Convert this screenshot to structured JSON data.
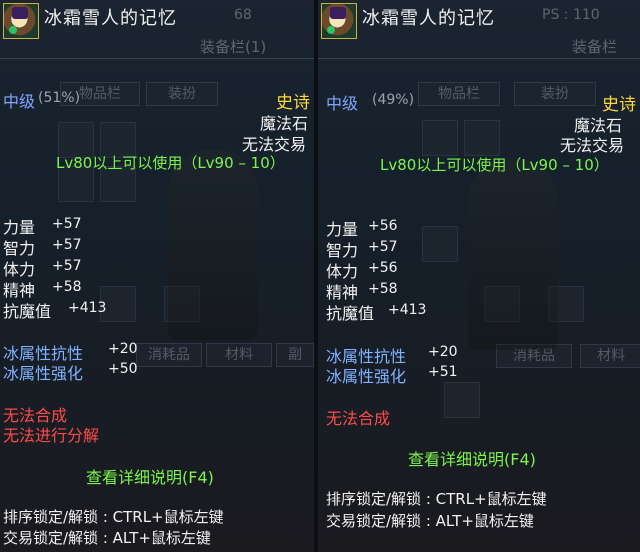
{
  "left": {
    "item_name": "冰霜雪人的记忆",
    "header_faded": "68",
    "window_title": "装备栏(1)",
    "bg_tabs": [
      "物品栏",
      "装扮",
      "消耗品",
      "材料",
      "副"
    ],
    "grade": "中级",
    "grade_pct": "(51%)",
    "rarity": "史诗",
    "item_type": "魔法石",
    "trade": "无法交易",
    "level_req": "Lv80以上可以使用（Lv90 – 10）",
    "stats": [
      {
        "name": "力量",
        "value": "+57"
      },
      {
        "name": "智力",
        "value": "+57"
      },
      {
        "name": "体力",
        "value": "+57"
      },
      {
        "name": "精神",
        "value": "+58"
      },
      {
        "name": "抗魔值",
        "value": "+413"
      }
    ],
    "elem": [
      {
        "name": "冰属性抗性",
        "value": "+20"
      },
      {
        "name": "冰属性强化",
        "value": "+50"
      }
    ],
    "no_synth": "无法合成",
    "no_decompose": "无法进行分解",
    "detail_btn": "查看详细说明(F4)",
    "lock_sort": "排序锁定/解锁 : CTRL+鼠标左键",
    "lock_trade": "交易锁定/解锁 : ALT+鼠标左键"
  },
  "right": {
    "item_name": "冰霜雪人的记忆",
    "header_faded": "PS : 110",
    "window_title": "装备栏",
    "bg_tabs": [
      "物品栏",
      "装扮",
      "消耗品",
      "材料"
    ],
    "grade": "中级",
    "grade_pct": "(49%)",
    "rarity": "史诗",
    "item_type": "魔法石",
    "trade": "无法交易",
    "level_req": "Lv80以上可以使用（Lv90 – 10）",
    "stats": [
      {
        "name": "力量",
        "value": "+56"
      },
      {
        "name": "智力",
        "value": "+57"
      },
      {
        "name": "体力",
        "value": "+56"
      },
      {
        "name": "精神",
        "value": "+58"
      },
      {
        "name": "抗魔值",
        "value": "+413"
      }
    ],
    "elem": [
      {
        "name": "冰属性抗性",
        "value": "+20"
      },
      {
        "name": "冰属性强化",
        "value": "+51"
      }
    ],
    "no_synth": "无法合成",
    "detail_btn": "查看详细说明(F4)",
    "lock_sort": "排序锁定/解锁 : CTRL+鼠标左键",
    "lock_trade": "交易锁定/解锁 : ALT+鼠标左键"
  },
  "colors": {
    "rarity": "#ffd93b",
    "requirement": "#7cf54b",
    "elemental": "#7fb2ff",
    "warning": "#ff4a4a"
  }
}
